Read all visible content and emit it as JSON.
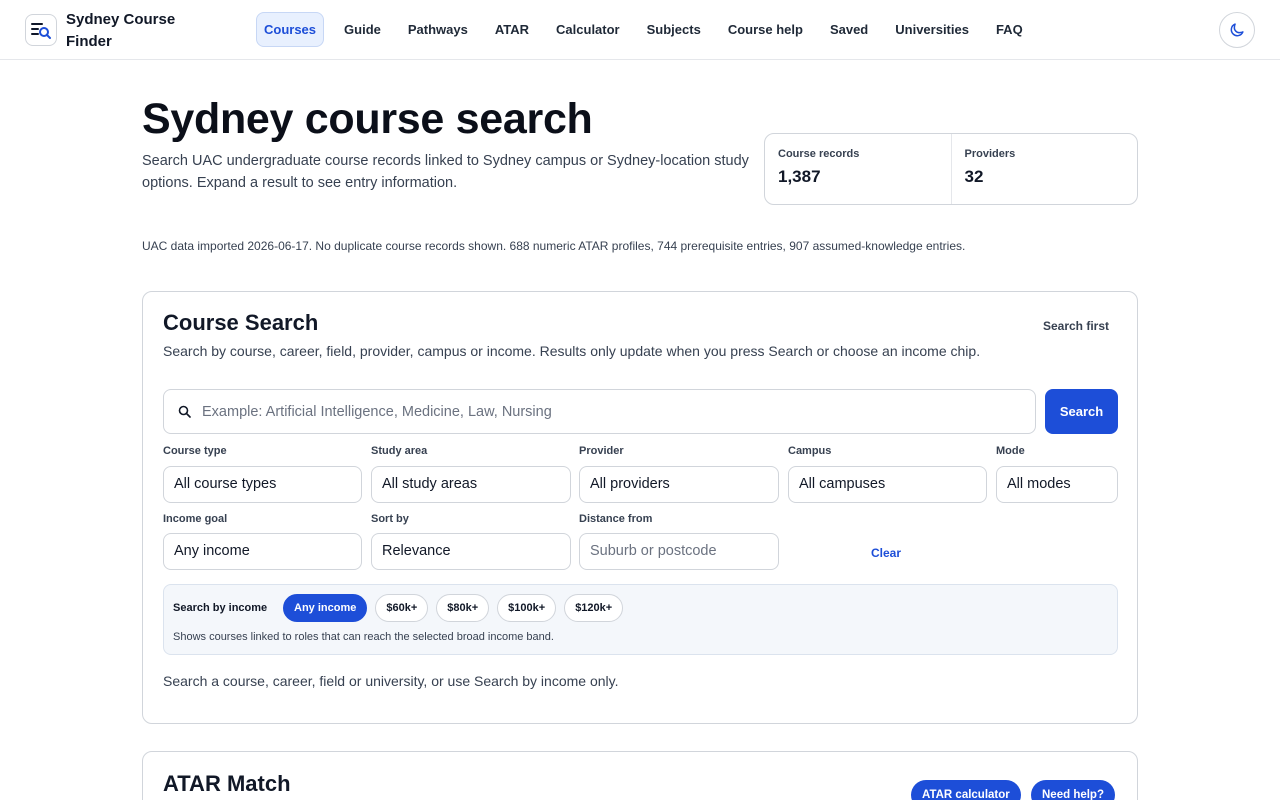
{
  "header": {
    "brand": "Sydney Course Finder",
    "nav": [
      {
        "label": "Courses",
        "active": true
      },
      {
        "label": "Guide"
      },
      {
        "label": "Pathways"
      },
      {
        "label": "ATAR"
      },
      {
        "label": "Calculator"
      },
      {
        "label": "Subjects"
      },
      {
        "label": "Course help"
      },
      {
        "label": "Saved"
      },
      {
        "label": "Universities"
      },
      {
        "label": "FAQ"
      }
    ],
    "theme_icon": "moon-icon",
    "logo_icon": "search-list-icon"
  },
  "hero": {
    "title": "Sydney course search",
    "description": "Search UAC undergraduate course records linked to Sydney campus or Sydney-location study options. Expand a result to see entry information.",
    "stats": [
      {
        "label": "Course records",
        "value": "1,387"
      },
      {
        "label": "Providers",
        "value": "32"
      }
    ],
    "import_note": "UAC data imported 2026-06-17. No duplicate course records shown. 688 numeric ATAR profiles, 744 prerequisite entries, 907 assumed-knowledge entries."
  },
  "search": {
    "title": "Course Search",
    "status": "Search first",
    "description": "Search by course, career, field, provider, campus or income. Results only update when you press Search or choose an income chip.",
    "placeholder": "Example: Artificial Intelligence, Medicine, Law, Nursing",
    "value": "",
    "button": "Search",
    "filters": {
      "course_type": {
        "label": "Course type",
        "value": "All course types"
      },
      "study_area": {
        "label": "Study area",
        "value": "All study areas"
      },
      "provider": {
        "label": "Provider",
        "value": "All providers"
      },
      "campus": {
        "label": "Campus",
        "value": "All campuses"
      },
      "mode": {
        "label": "Mode",
        "value": "All modes"
      },
      "income_goal": {
        "label": "Income goal",
        "value": "Any income"
      },
      "sort_by": {
        "label": "Sort by",
        "value": "Relevance"
      },
      "distance_from": {
        "label": "Distance from",
        "placeholder": "Suburb or postcode"
      }
    },
    "clear": "Clear",
    "income": {
      "label": "Search by income",
      "chips": [
        "Any income",
        "$60k+",
        "$80k+",
        "$100k+",
        "$120k+"
      ],
      "selected": "Any income",
      "note": "Shows courses linked to roles that can reach the selected broad income band."
    },
    "results_note": "Search a course, career, field or university, or use Search by income only."
  },
  "atar": {
    "title": "ATAR Match",
    "buttons": [
      "ATAR calculator",
      "Need help?"
    ]
  },
  "colors": {
    "accent": "#1d4ed8",
    "active_nav_bg": "#e8f0fe",
    "border": "#d1d5db"
  }
}
